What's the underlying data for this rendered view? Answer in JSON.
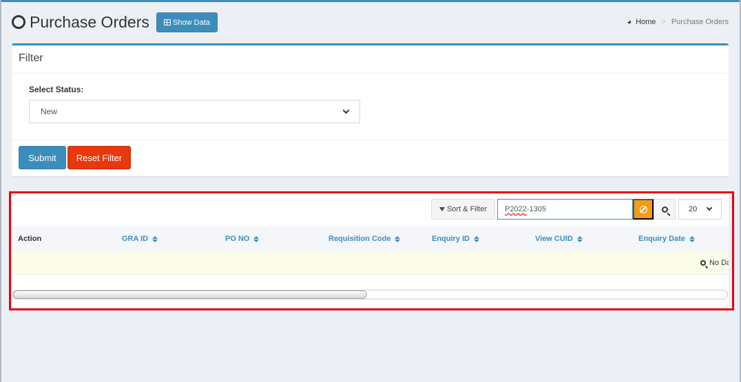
{
  "header": {
    "title": "Purchase Orders",
    "show_data_label": "Show Data"
  },
  "breadcrumb": {
    "home": "Home",
    "separator": ">",
    "current": "Purchase Orders"
  },
  "filter": {
    "title": "Filter",
    "status_label": "Select Status:",
    "status_value": "New",
    "submit_label": "Submit",
    "reset_label": "Reset Filter"
  },
  "table": {
    "sort_filter_label": "Sort & Filter",
    "search_value": "P2022-1305",
    "search_value_part1": "P2022",
    "search_value_part2": "-1305",
    "page_size": "20",
    "columns": [
      "Action",
      "GRA ID",
      "PO NO",
      "Requisition Code",
      "Enquiry ID",
      "View CUID",
      "Enquiry Date"
    ],
    "no_data": "No Data"
  },
  "colors": {
    "primary": "#3c8dbc",
    "danger": "#e8380d",
    "warning": "#f39c12",
    "highlight": "#e8000b"
  }
}
